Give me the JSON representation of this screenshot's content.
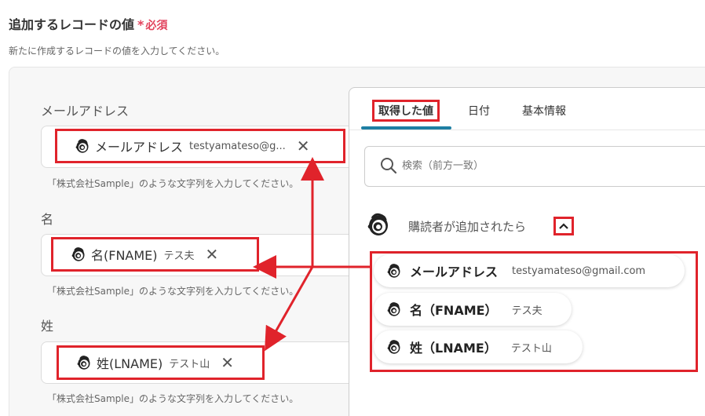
{
  "section": {
    "title": "追加するレコードの値",
    "required_mark": "*",
    "required_text": "必須",
    "description": "新たに作成するレコードの値を入力してください。"
  },
  "fields": [
    {
      "label": "メールアドレス",
      "chip_label": "メールアドレス",
      "chip_value": "testyamateso@g...",
      "hint": "「株式会社Sample」のような文字列を入力してください。"
    },
    {
      "label": "名",
      "chip_label": "名(FNAME)",
      "chip_value": "テス夫",
      "hint": "「株式会社Sample」のような文字列を入力してください。"
    },
    {
      "label": "姓",
      "chip_label": "姓(LNAME)",
      "chip_value": "テスト山",
      "hint": "「株式会社Sample」のような文字列を入力してください。"
    }
  ],
  "dropdown": {
    "tabs": [
      "取得した値",
      "日付",
      "基本情報"
    ],
    "active_tab": 0,
    "search_placeholder": "検索（前方一致）",
    "group_title": "購読者が追加されたら",
    "options": [
      {
        "label": "メールアドレス",
        "value": "testyamateso@gmail.com"
      },
      {
        "label": "名（FNAME）",
        "value": "テス夫"
      },
      {
        "label": "姓（LNAME）",
        "value": "テスト山"
      }
    ]
  },
  "colors": {
    "highlight_red": "#e0232b",
    "required_red": "#e2425c",
    "tab_underline": "#1e7fa3"
  },
  "icons": {
    "chip_icon": "mailchimp-icon",
    "close_icon": "close-icon",
    "search_icon": "search-icon",
    "toggle_icon": "chevron-up-icon"
  }
}
